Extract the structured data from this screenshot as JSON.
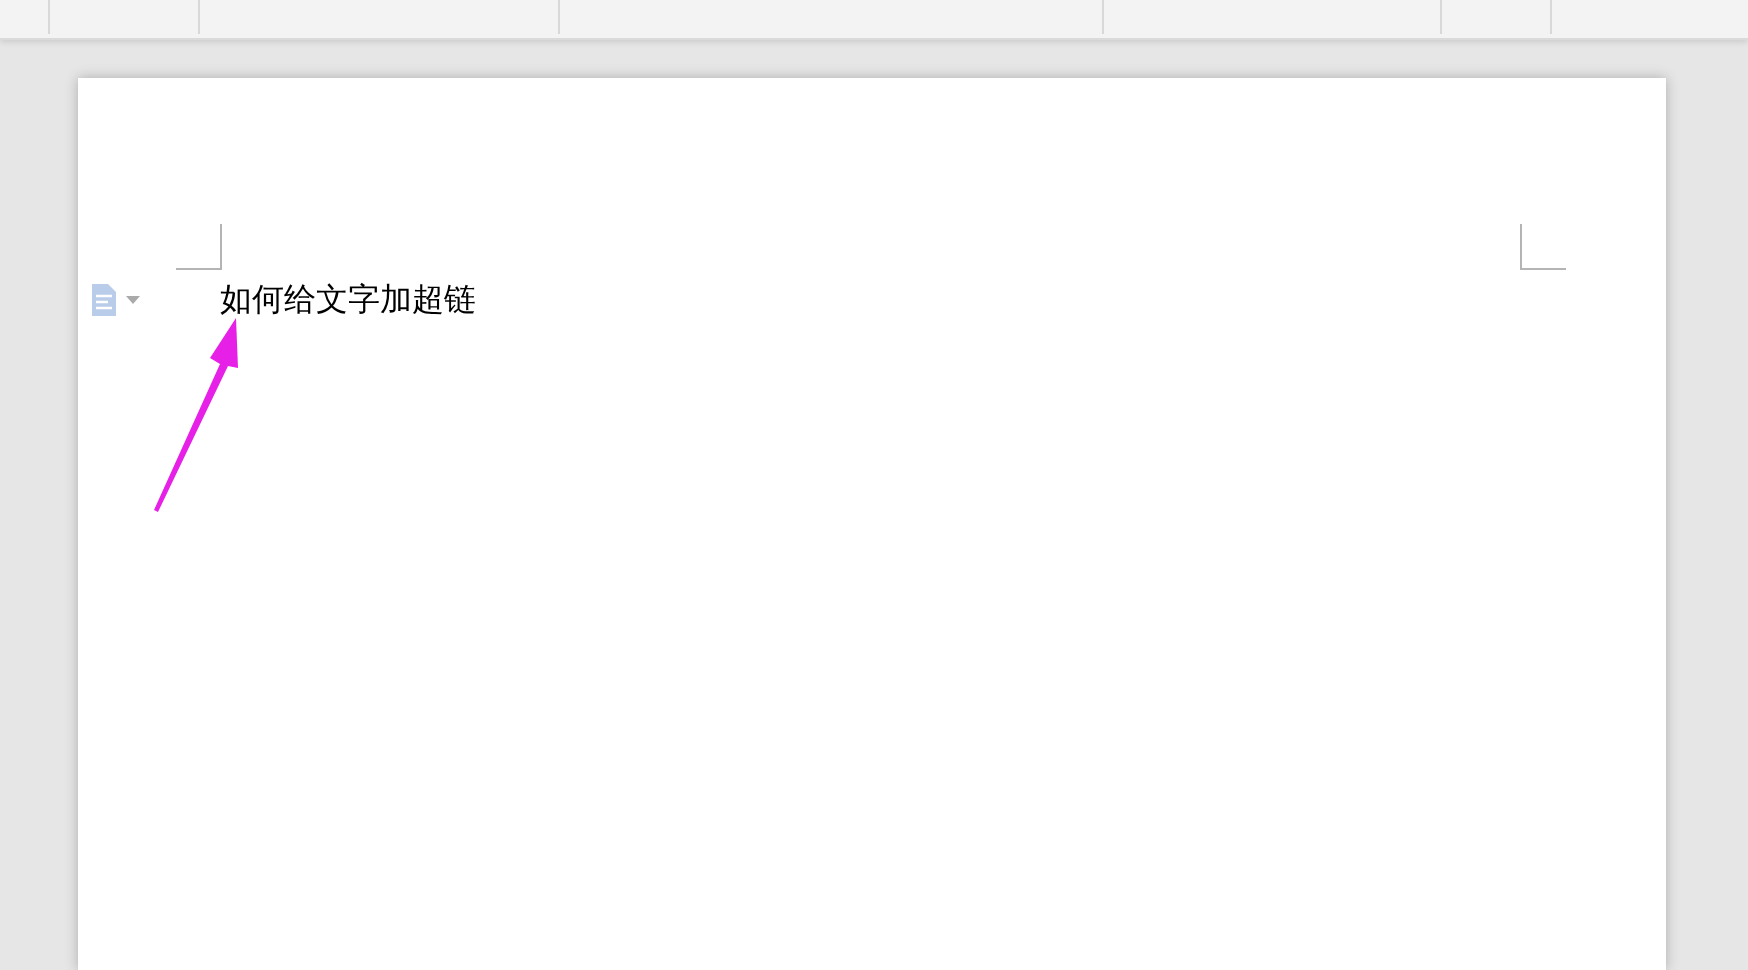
{
  "document": {
    "paragraphs": [
      "如何给文字加超链"
    ]
  }
}
